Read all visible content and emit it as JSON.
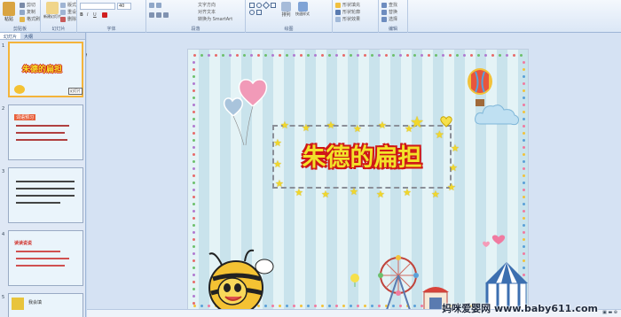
{
  "ribbon": {
    "clipboard": {
      "label": "剪贴板",
      "paste": "粘贴",
      "cut": "剪切",
      "copy": "复制",
      "format": "格式刷"
    },
    "slides": {
      "label": "幻灯片",
      "new_slide": "新建幻灯片",
      "layout": "版式",
      "reset": "重设",
      "delete": "删除"
    },
    "font": {
      "label": "字体",
      "size": "40"
    },
    "paragraph": {
      "label": "段落",
      "text_direction": "文字方向",
      "align_text": "对齐文本",
      "smartart": "转换为 SmartArt"
    },
    "drawing": {
      "label": "绘图",
      "arrange": "排列",
      "quick_styles": "快速样式",
      "fill": "形状填充",
      "outline": "形状轮廓",
      "effects": "形状效果"
    },
    "editing": {
      "label": "编辑",
      "find": "查找",
      "replace": "替换",
      "select": "选择"
    }
  },
  "left_pane": {
    "tab_slides": "幻灯片",
    "tab_outline": "大纲",
    "thumbs": [
      {
        "num": "1",
        "title": "朱德的扁担",
        "tip": "幻灯片"
      },
      {
        "num": "2",
        "title": "词语预习"
      },
      {
        "num": "3",
        "title": ""
      },
      {
        "num": "4",
        "title": "读读说说"
      },
      {
        "num": "5",
        "title": "我会填"
      }
    ]
  },
  "slide": {
    "title": "朱德的扁担"
  },
  "status": {
    "watermark": "妈咪爱婴网 www.baby611.com"
  },
  "colors": {
    "title_fill": "#f2e22a",
    "title_stroke": "#d01818",
    "selection": "#f4b43a"
  }
}
